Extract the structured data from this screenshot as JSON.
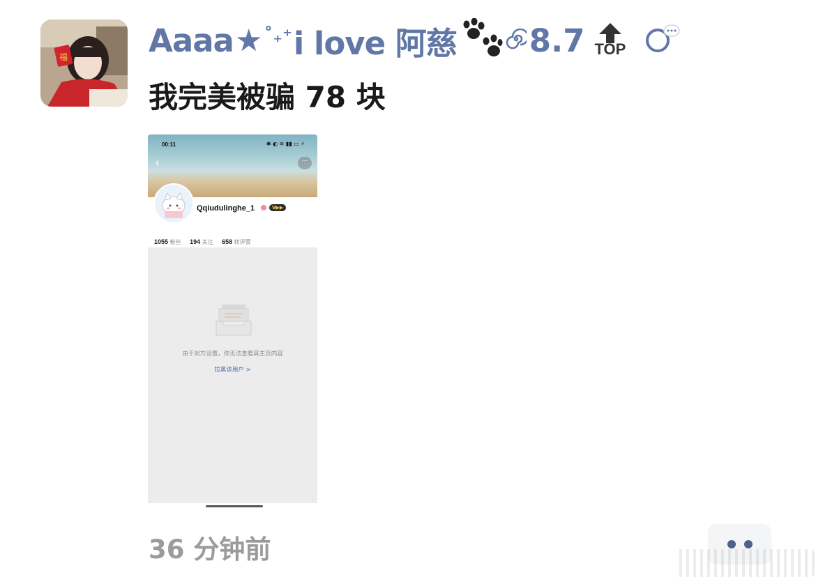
{
  "post": {
    "author_name": "Aaaa",
    "author_name_suffix": "i love 阿慈",
    "score": "8.7",
    "top_label": "TOP",
    "text": "我完美被骗 78 块",
    "timestamp": "36 分钟前"
  },
  "embedded_screenshot": {
    "status_time": "00:11",
    "profile_name": "Qqiudulinghe_1",
    "stats": [
      {
        "value": "1055",
        "label": "粉丝"
      },
      {
        "value": "194",
        "label": "关注"
      },
      {
        "value": "658",
        "label": "转评赞"
      }
    ],
    "empty_message": "由于对方设置，你无法查看其主页内容",
    "action_link": "拉黑该用户 >"
  },
  "icons": {
    "star": "star-icon",
    "paw": "paw-icon",
    "spiral": "spiral-icon",
    "top_arrow": "top-arrow-icon",
    "more": "more-dots-icon"
  },
  "colors": {
    "username": "#6177a8",
    "timestamp": "#9b9b9b",
    "more_dots": "#4f6089"
  }
}
